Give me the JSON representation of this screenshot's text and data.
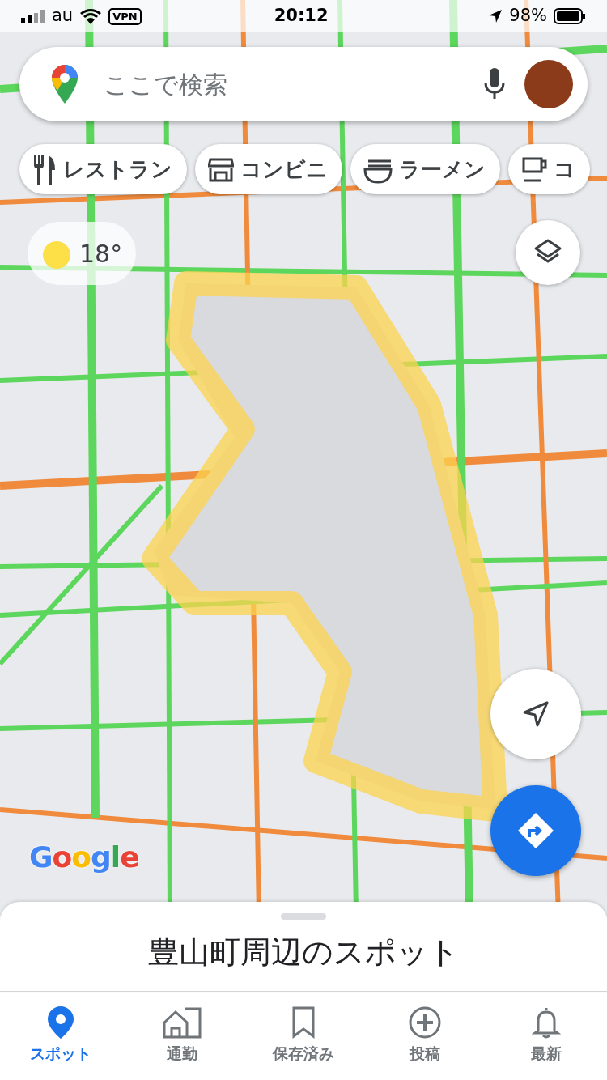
{
  "status_bar": {
    "carrier": "au",
    "vpn": "VPN",
    "time": "20:12",
    "battery": "98%"
  },
  "search": {
    "placeholder": "ここで検索"
  },
  "chips": [
    {
      "label": "レストラン",
      "kind": "restaurant"
    },
    {
      "label": "コンビニ",
      "kind": "store"
    },
    {
      "label": "ラーメン",
      "kind": "ramen"
    },
    {
      "label": "コ",
      "kind": "cafe"
    }
  ],
  "weather": {
    "temperature": "18°"
  },
  "map": {
    "logo": "Google"
  },
  "sheet": {
    "title": "豊山町周辺のスポット"
  },
  "tabs": [
    {
      "label": "スポット",
      "kind": "explore",
      "selected": true
    },
    {
      "label": "通勤",
      "kind": "commute",
      "selected": false
    },
    {
      "label": "保存済み",
      "kind": "saved",
      "selected": false
    },
    {
      "label": "投稿",
      "kind": "contribute",
      "selected": false
    },
    {
      "label": "最新",
      "kind": "updates",
      "selected": false
    }
  ]
}
